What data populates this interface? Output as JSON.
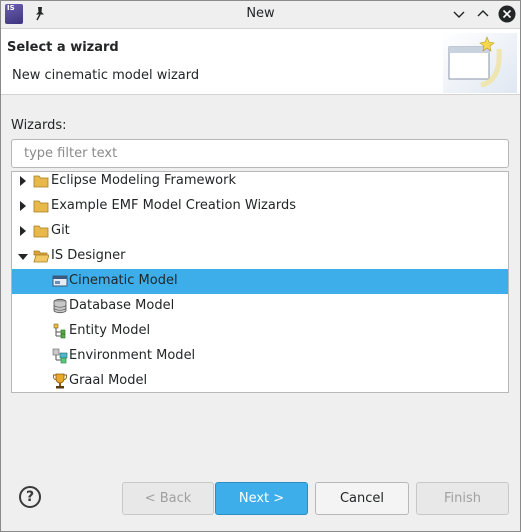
{
  "window": {
    "title": "New",
    "app_icon_text": "IS"
  },
  "header": {
    "title": "Select a wizard",
    "description": "New cinematic model wizard"
  },
  "wizards": {
    "label": "Wizards:",
    "filter_placeholder": "type filter text",
    "filter_value": ""
  },
  "tree": {
    "items": [
      {
        "label": "Eclipse Modeling Framework",
        "expanded": false,
        "icon": "folder-icon",
        "level": 0
      },
      {
        "label": "Example EMF Model Creation Wizards",
        "expanded": false,
        "icon": "folder-icon",
        "level": 0
      },
      {
        "label": "Git",
        "expanded": false,
        "icon": "folder-icon",
        "level": 0
      },
      {
        "label": "IS Designer",
        "expanded": true,
        "icon": "folder-open-icon",
        "level": 0
      },
      {
        "label": "Cinematic Model",
        "selected": true,
        "icon": "cinematic-model-icon",
        "level": 1
      },
      {
        "label": "Database Model",
        "icon": "database-icon",
        "level": 1
      },
      {
        "label": "Entity Model",
        "icon": "entity-model-icon",
        "level": 1
      },
      {
        "label": "Environment Model",
        "icon": "environment-model-icon",
        "level": 1
      },
      {
        "label": "Graal Model",
        "icon": "graal-trophy-icon",
        "level": 1
      }
    ]
  },
  "footer": {
    "help": "?",
    "back_label": "< Back",
    "next_label": "Next >",
    "cancel_label": "Cancel",
    "finish_label": "Finish"
  },
  "colors": {
    "selection": "#3daee9",
    "folder": "#e8b84a",
    "window_bg": "#efefef"
  }
}
